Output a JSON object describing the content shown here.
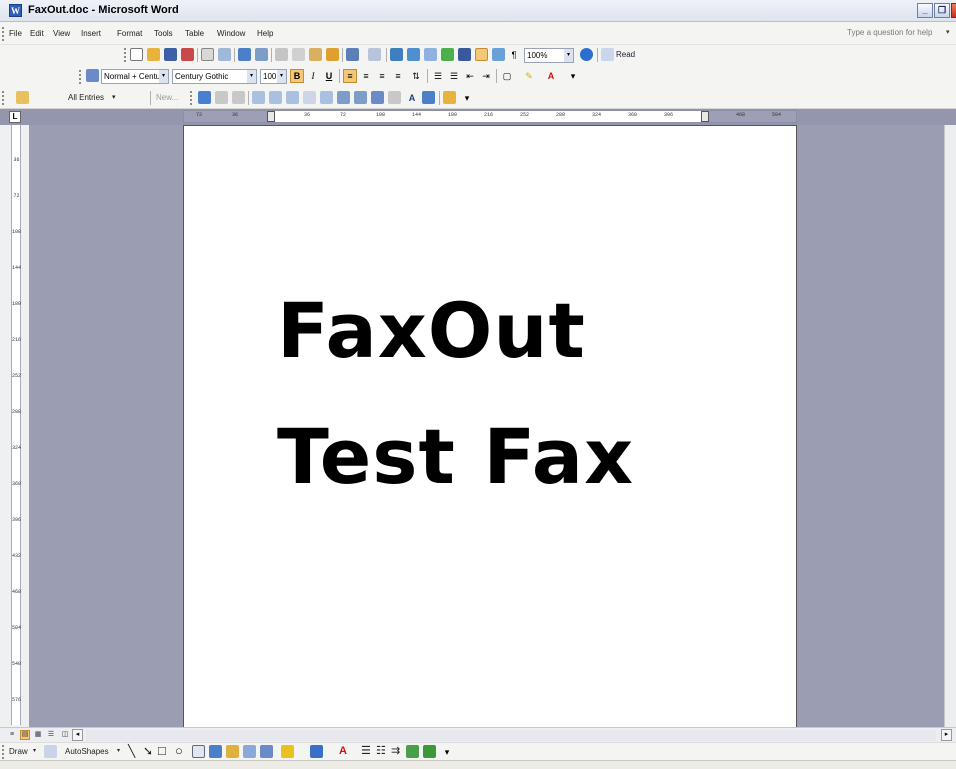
{
  "window": {
    "title": "FaxOut.doc - Microsoft Word",
    "app_icon": "word-doc-icon",
    "accent": "#2f5fb8"
  },
  "menubar": {
    "items": [
      "File",
      "Edit",
      "View",
      "Insert",
      "Format",
      "Tools",
      "Table",
      "Window",
      "Help"
    ],
    "ask_question": "Type a question for help"
  },
  "standard_toolbar": {
    "zoom": "100%",
    "read_label": "Read"
  },
  "formatting_toolbar": {
    "style": "Normal + Centu",
    "font": "Century Gothic",
    "size": "100",
    "bold": "B",
    "italic": "I",
    "underline": "U"
  },
  "mailmerge_toolbar": {
    "entries": "All Entries",
    "new_label": "New..."
  },
  "ruler": {
    "tab_selector": "L",
    "h_ticks": [
      "72",
      "36",
      "36",
      "72",
      "108",
      "144",
      "180",
      "216",
      "252",
      "288",
      "324",
      "360",
      "396",
      "468",
      "504"
    ],
    "v_ticks": [
      "36",
      "72",
      "108",
      "144",
      "180",
      "216",
      "252",
      "288",
      "324",
      "360",
      "396",
      "432",
      "468",
      "504",
      "540",
      "576"
    ]
  },
  "document": {
    "line1": "FaxOut",
    "line2": "Test Fax"
  },
  "drawing_toolbar": {
    "draw_label": "Draw",
    "autoshapes_label": "AutoShapes"
  },
  "colors": {
    "doc_background": "#9b9eb3",
    "toolbar": "#f4f4f2",
    "active_button": "#f4c676"
  }
}
